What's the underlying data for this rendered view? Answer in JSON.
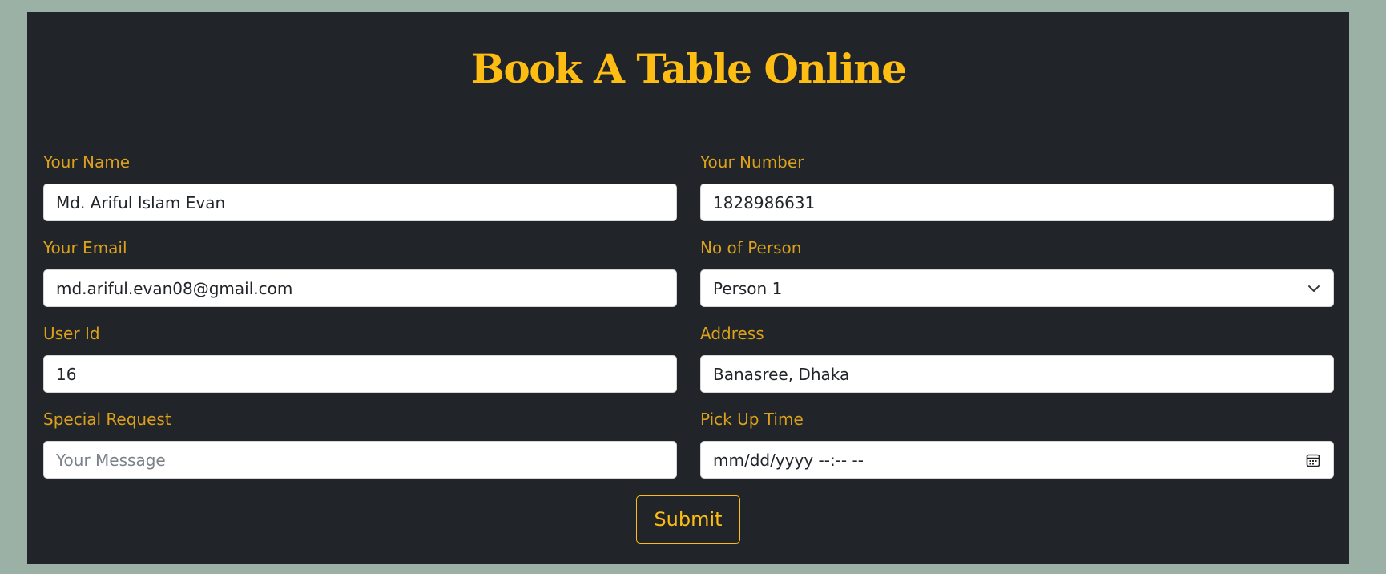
{
  "page": {
    "title": "Book A Table Online",
    "colors": {
      "page_background": "#9bb1a6",
      "panel_background": "#212429",
      "accent": "#fdbd12",
      "label": "#dba11b"
    }
  },
  "form": {
    "name": {
      "label": "Your Name",
      "value": "Md. Ariful Islam Evan"
    },
    "number": {
      "label": "Your Number",
      "value": "1828986631"
    },
    "email": {
      "label": "Your Email",
      "value": "md.ariful.evan08@gmail.com"
    },
    "persons": {
      "label": "No of Person",
      "selected": "Person 1",
      "icon": "chevron-down-icon"
    },
    "user_id": {
      "label": "User Id",
      "value": "16"
    },
    "address": {
      "label": "Address",
      "value": "Banasree, Dhaka"
    },
    "special_request": {
      "label": "Special Request",
      "value": "",
      "placeholder": "Your Message"
    },
    "pickup_time": {
      "label": "Pick Up Time",
      "value": "mm/dd/yyyy --:-- --",
      "icon": "calendar-icon"
    },
    "submit_label": "Submit"
  }
}
